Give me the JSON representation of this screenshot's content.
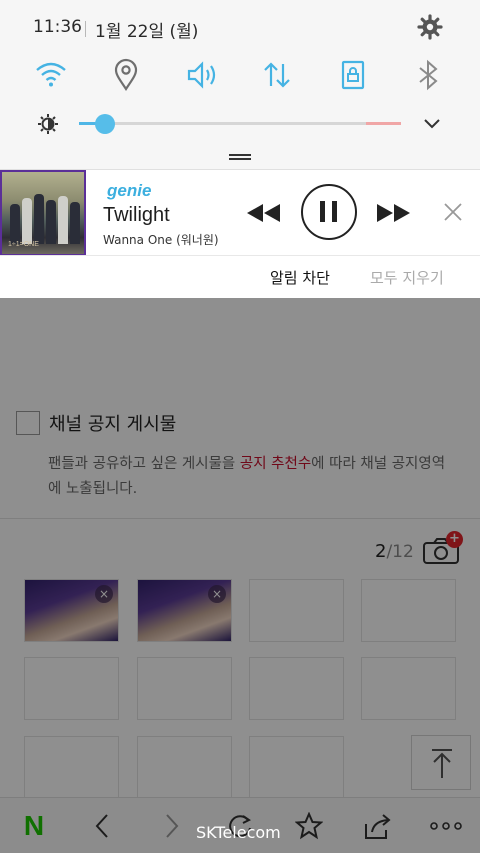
{
  "status": {
    "time": "11:36",
    "date": "1월 22일 (월)"
  },
  "quick_settings": [
    "wifi-icon",
    "location-icon",
    "sound-icon",
    "mobile-data-icon",
    "screen-rotation-lock-icon",
    "bluetooth-icon"
  ],
  "brightness": {
    "level": 0.08
  },
  "media": {
    "app": "genie",
    "title": "Twilight",
    "artist": "Wanna One (워너원)",
    "album_art_text": "1÷1=ONE"
  },
  "actions": {
    "block": "알림 차단",
    "clear_all": "모두 지우기"
  },
  "background": {
    "notice_title": "채널 공지 게시물",
    "notice_desc_before": "팬들과 공유하고 싶은 게시물을 ",
    "notice_desc_highlight": "공지 추천수",
    "notice_desc_after": "에 따라 채널 공지영역에 노출됩니다.",
    "photo_count": "2",
    "photo_total": "/12",
    "camera_badge": "+",
    "remove_glyph": "×"
  },
  "bottom_bar": {
    "carrier": "SKTelecom",
    "naver": "N"
  },
  "colors": {
    "accent": "#4fb6e6",
    "highlight": "#c8102e",
    "naver_green": "#1ec800"
  }
}
